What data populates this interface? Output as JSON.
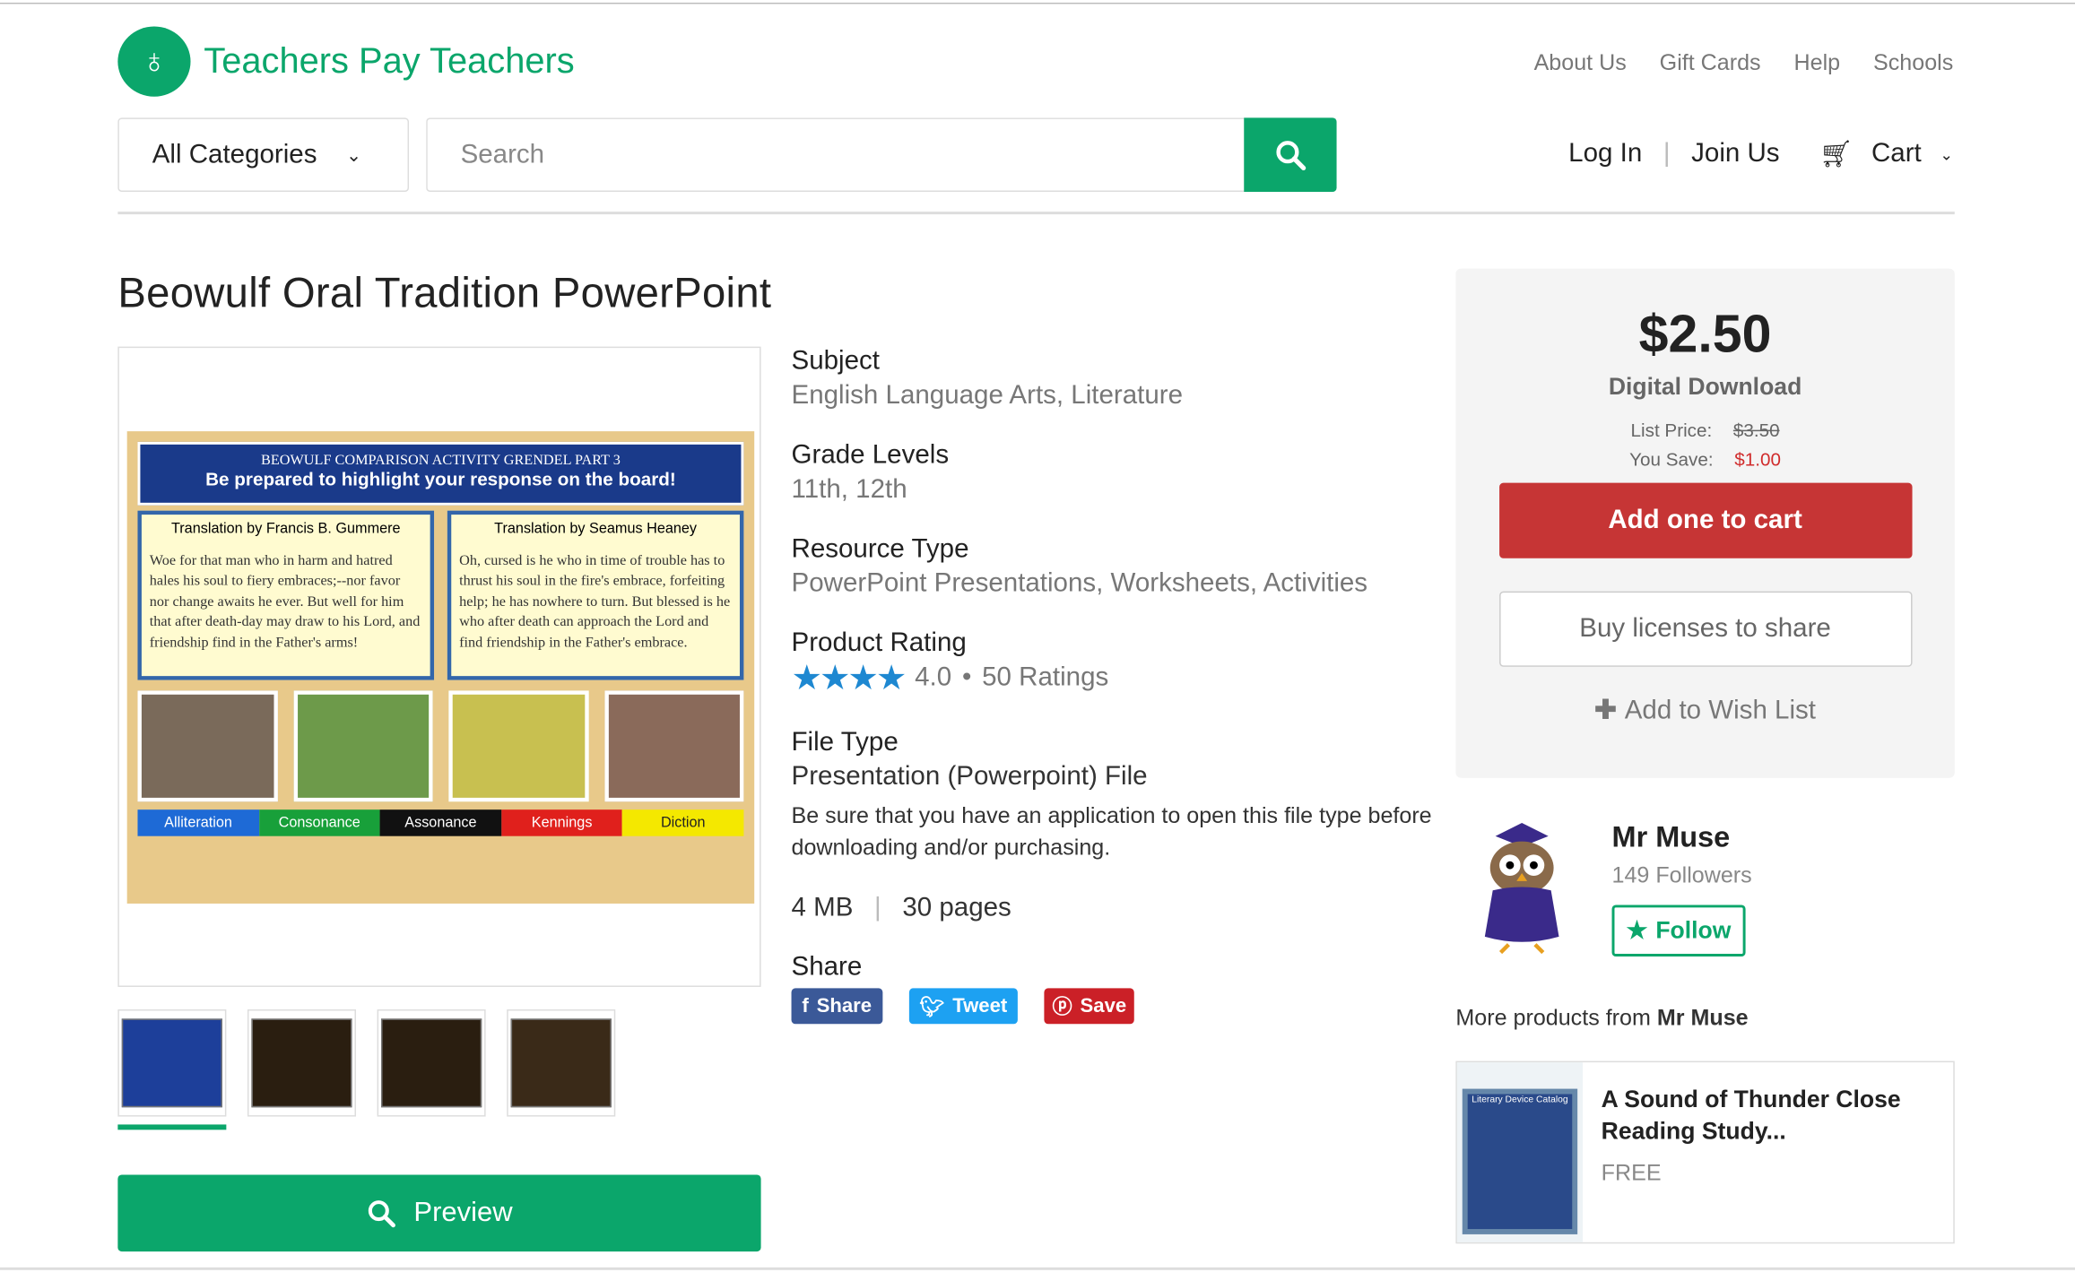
{
  "header": {
    "logo_text": "Teachers Pay Teachers",
    "top_links": [
      "About Us",
      "Gift Cards",
      "Help",
      "Schools"
    ],
    "category_select": "All Categories",
    "search_placeholder": "Search",
    "login": "Log In",
    "join": "Join Us",
    "cart": "Cart"
  },
  "product": {
    "title": "Beowulf Oral Tradition PowerPoint",
    "slide": {
      "heading_top": "BEOWULF COMPARISON ACTIVITY GRENDEL PART 3",
      "heading_main": "Be prepared to highlight your response on the board!",
      "left_title": "Translation by Francis B. Gummere",
      "left_text": "Woe for that man who in harm and hatred hales his soul to fiery embraces;--nor favor nor change awaits he ever. But well for him that after death-day may draw to his Lord, and friendship find in the Father's arms!",
      "right_title": "Translation by Seamus Heaney",
      "right_text": "Oh, cursed is he who in time of trouble has to thrust his soul in the fire's embrace, forfeiting help; he has nowhere to turn. But blessed is he who after death can approach the Lord and find friendship in the Father's embrace.",
      "labels": [
        "Alliteration",
        "Consonance",
        "Assonance",
        "Kennings",
        "Diction"
      ]
    },
    "preview_label": "Preview",
    "subject_label": "Subject",
    "subject": "English Language Arts, Literature",
    "grade_label": "Grade Levels",
    "grades": "11th, 12th",
    "resource_label": "Resource Type",
    "resource": "PowerPoint Presentations, Worksheets, Activities",
    "rating_label": "Product Rating",
    "rating": "4.0",
    "rating_count": "50 Ratings",
    "filetype_label": "File Type",
    "filetype": "Presentation (Powerpoint) File",
    "filetype_note": "Be sure that you have an application to open this file type before downloading and/or purchasing.",
    "size": "4 MB",
    "pages": "30 pages",
    "share_label": "Share",
    "share_buttons": [
      "Share",
      "Tweet",
      "Save"
    ]
  },
  "purchase": {
    "price": "$2.50",
    "type": "Digital Download",
    "list_price_label": "List Price:",
    "list_price": "$3.50",
    "save_label": "You Save:",
    "save": "$1.00",
    "add_cart": "Add one to cart",
    "buy_licenses": "Buy licenses to share",
    "wish_list": "Add to Wish List"
  },
  "seller": {
    "name": "Mr Muse",
    "followers": "149 Followers",
    "follow": "Follow",
    "more_prefix": "More products from ",
    "more_name": "Mr Muse"
  },
  "related": {
    "title": "A Sound of Thunder Close Reading Study...",
    "price": "FREE",
    "thumb_heading": "Literary Device Catalog"
  },
  "colors": {
    "brand": "#0ba66b",
    "cart": "#c63535",
    "star": "#1e88d1"
  }
}
